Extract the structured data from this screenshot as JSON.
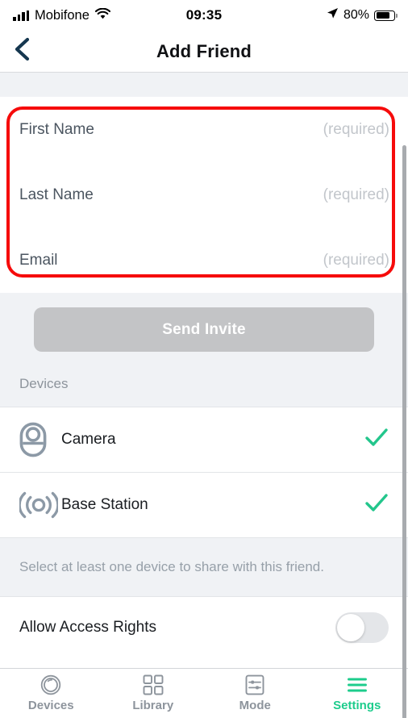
{
  "status_bar": {
    "carrier": "Mobifone",
    "signal_icon": "signal-bars-icon",
    "wifi_icon": "wifi-icon",
    "time": "09:35",
    "location_icon": "location-arrow-icon",
    "battery_percent": "80%",
    "battery_icon": "battery-icon",
    "battery_level": 80
  },
  "nav": {
    "back_icon": "chevron-left-icon",
    "title": "Add Friend"
  },
  "form": {
    "fields": [
      {
        "label": "First Name",
        "value": "",
        "placeholder": "(required)"
      },
      {
        "label": "Last Name",
        "value": "",
        "placeholder": "(required)"
      },
      {
        "label": "Email",
        "value": "",
        "placeholder": "(required)"
      }
    ]
  },
  "invite": {
    "button_label": "Send Invite",
    "enabled": false
  },
  "devices": {
    "header": "Devices",
    "items": [
      {
        "name": "Camera",
        "icon": "camera-icon",
        "selected": true,
        "check_icon": "check-icon"
      },
      {
        "name": "Base Station",
        "icon": "base-station-icon",
        "selected": true,
        "check_icon": "check-icon"
      }
    ],
    "hint": "Select at least one device to share with this friend."
  },
  "access": {
    "label": "Allow Access Rights",
    "toggle_state": "off"
  },
  "tabbar": {
    "items": [
      {
        "label": "Devices",
        "icon": "camera-lens-icon",
        "active": false
      },
      {
        "label": "Library",
        "icon": "grid-icon",
        "active": false
      },
      {
        "label": "Mode",
        "icon": "sliders-icon",
        "active": false
      },
      {
        "label": "Settings",
        "icon": "menu-lines-icon",
        "active": true
      }
    ]
  },
  "annotation": {
    "shape": "rounded-rectangle-highlight",
    "color": "#F60B0B"
  },
  "colors": {
    "accent_green": "#1DCC8C",
    "check_green": "#23C68C",
    "disabled_button": "#C3C4C6",
    "section_bg": "#F0F2F5",
    "muted_text": "#8D949C",
    "annotation_red": "#F60B0B"
  }
}
